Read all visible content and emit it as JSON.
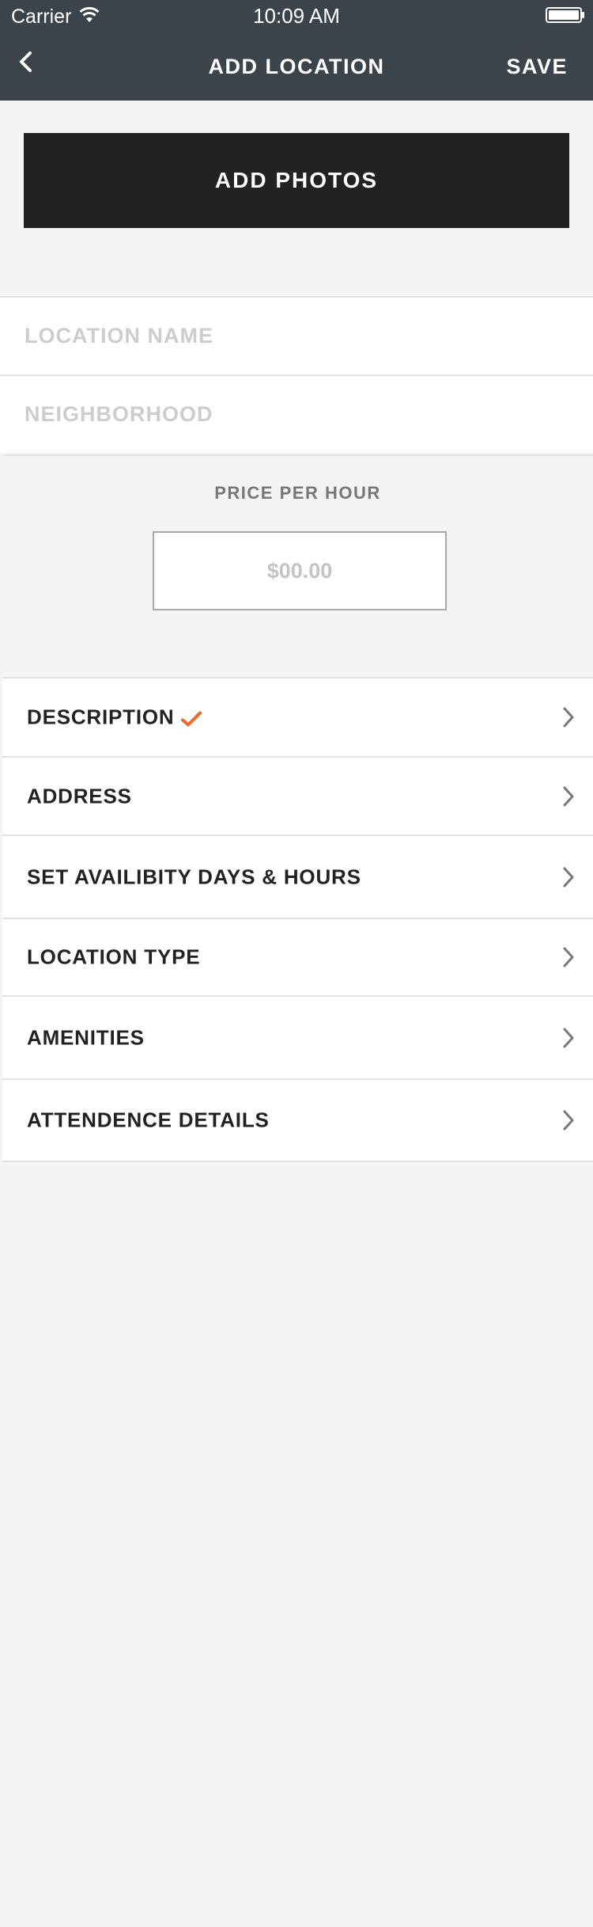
{
  "status_bar": {
    "carrier": "Carrier",
    "time": "10:09 AM"
  },
  "nav": {
    "title": "ADD LOCATION",
    "save_label": "SAVE",
    "back_icon": "chevron-left-icon"
  },
  "add_photos_label": "ADD PHOTOS",
  "fields": {
    "location_name": {
      "placeholder": "LOCATION NAME",
      "value": ""
    },
    "neighborhood": {
      "placeholder": "NEIGHBORHOOD",
      "value": ""
    }
  },
  "price": {
    "label": "PRICE PER HOUR",
    "placeholder": "$00.00",
    "value": ""
  },
  "menu": {
    "items": [
      {
        "label": "DESCRIPTION",
        "checked": true
      },
      {
        "label": "ADDRESS",
        "checked": false
      },
      {
        "label": "SET AVAILIBITY DAYS & HOURS",
        "checked": false
      },
      {
        "label": "LOCATION TYPE",
        "checked": false
      },
      {
        "label": "AMENITIES",
        "checked": false
      },
      {
        "label": "ATTENDENCE DETAILS",
        "checked": false
      }
    ]
  },
  "colors": {
    "header_bg": "#3b434b",
    "button_bg": "#222222",
    "check_accent": "#f26522",
    "page_bg": "#f4f4f4"
  }
}
